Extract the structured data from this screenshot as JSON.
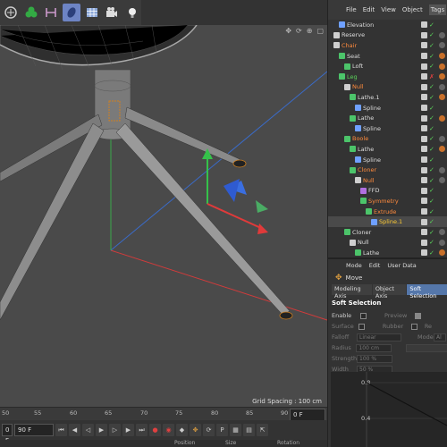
{
  "object_manager": {
    "menu": [
      "File",
      "Edit",
      "View",
      "Object",
      "Tags",
      "Bo"
    ],
    "active_menu": "Tags",
    "rows": [
      {
        "label": "Elevation",
        "indent": 1,
        "icon": "blue-arrow-icon",
        "color": "#dddddd",
        "mark": "✓",
        "mark_color": "#5bd35b",
        "tag_color": ""
      },
      {
        "label": "Reserve",
        "indent": 0,
        "icon": "null-icon",
        "color": "#dddddd",
        "mark": "✓",
        "mark_color": "#5bd35b",
        "tag_color": "#666666"
      },
      {
        "label": "Chair",
        "indent": 0,
        "icon": "null-icon",
        "color": "#ff8a3c",
        "mark": "✓",
        "mark_color": "#5bd35b",
        "tag_color": "#666666"
      },
      {
        "label": "Seat",
        "indent": 1,
        "icon": "generator-icon",
        "color": "#dddddd",
        "mark": "✓",
        "mark_color": "#5bd35b",
        "tag_color": "#c8702a"
      },
      {
        "label": "Loft",
        "indent": 2,
        "icon": "loft-icon",
        "color": "#dddddd",
        "mark": "✓",
        "mark_color": "#5bd35b",
        "tag_color": "#c8702a"
      },
      {
        "label": "Leg",
        "indent": 1,
        "icon": "generator-icon",
        "color": "#5bd35b",
        "mark": "✗",
        "mark_color": "#e04040",
        "tag_color": "#c8702a"
      },
      {
        "label": "Null",
        "indent": 2,
        "icon": "null-icon",
        "color": "#ff8a3c",
        "mark": "✓",
        "mark_color": "#5bd35b",
        "tag_color": "#666666"
      },
      {
        "label": "Lathe.1",
        "indent": 3,
        "icon": "lathe-icon",
        "color": "#dddddd",
        "mark": "✓",
        "mark_color": "#5bd35b",
        "tag_color": "#c8702a"
      },
      {
        "label": "Spline",
        "indent": 4,
        "icon": "spline-icon",
        "color": "#dddddd",
        "mark": "✓",
        "mark_color": "#5bd35b",
        "tag_color": ""
      },
      {
        "label": "Lathe",
        "indent": 3,
        "icon": "lathe-icon",
        "color": "#dddddd",
        "mark": "✓",
        "mark_color": "#5bd35b",
        "tag_color": "#c8702a"
      },
      {
        "label": "Spline",
        "indent": 4,
        "icon": "spline-icon",
        "color": "#dddddd",
        "mark": "✓",
        "mark_color": "#5bd35b",
        "tag_color": ""
      },
      {
        "label": "Boole",
        "indent": 2,
        "icon": "boole-icon",
        "color": "#ff8a3c",
        "mark": "✓",
        "mark_color": "#5bd35b",
        "tag_color": "#666666"
      },
      {
        "label": "Lathe",
        "indent": 3,
        "icon": "lathe-icon",
        "color": "#dddddd",
        "mark": "✓",
        "mark_color": "#5bd35b",
        "tag_color": "#c8702a"
      },
      {
        "label": "Spline",
        "indent": 4,
        "icon": "spline-icon",
        "color": "#dddddd",
        "mark": "✓",
        "mark_color": "#5bd35b",
        "tag_color": ""
      },
      {
        "label": "Cloner",
        "indent": 3,
        "icon": "cloner-icon",
        "color": "#ff8a3c",
        "mark": "✓",
        "mark_color": "#5bd35b",
        "tag_color": "#666666"
      },
      {
        "label": "Null",
        "indent": 4,
        "icon": "null-icon",
        "color": "#ff8a3c",
        "mark": "✓",
        "mark_color": "#5bd35b",
        "tag_color": "#666666"
      },
      {
        "label": "FFD",
        "indent": 5,
        "icon": "ffd-icon",
        "color": "#dddddd",
        "mark": "✓",
        "mark_color": "#5bd35b",
        "tag_color": ""
      },
      {
        "label": "Symmetry",
        "indent": 5,
        "icon": "symmetry-icon",
        "color": "#ff8a3c",
        "mark": "✓",
        "mark_color": "#5bd35b",
        "tag_color": ""
      },
      {
        "label": "Extrude",
        "indent": 6,
        "icon": "extrude-icon",
        "color": "#ff8a3c",
        "mark": "✓",
        "mark_color": "#5bd35b",
        "tag_color": ""
      },
      {
        "label": "Spline.1",
        "indent": 7,
        "icon": "spline-icon",
        "color": "#ffcc33",
        "mark": "✓",
        "mark_color": "#5bd35b",
        "tag_color": "",
        "highlight": true
      },
      {
        "label": "Cloner",
        "indent": 2,
        "icon": "cloner-icon",
        "color": "#dddddd",
        "mark": "✓",
        "mark_color": "#5bd35b",
        "tag_color": "#666666"
      },
      {
        "label": "Null",
        "indent": 3,
        "icon": "null-icon",
        "color": "#dddddd",
        "mark": "✓",
        "mark_color": "#5bd35b",
        "tag_color": "#666666"
      },
      {
        "label": "Lathe",
        "indent": 4,
        "icon": "lathe-icon",
        "color": "#dddddd",
        "mark": "✓",
        "mark_color": "#5bd35b",
        "tag_color": "#c8702a"
      }
    ]
  },
  "attributes": {
    "menu": [
      "Mode",
      "Edit",
      "User Data"
    ],
    "mode": "Move",
    "tabs": [
      "Modeling Axis",
      "Object Axis",
      "Soft Selection"
    ],
    "active_tab": "Soft Selection",
    "section": "Soft Selection",
    "enable_label": "Enable",
    "preview_label": "Preview",
    "surface_label": "Surface",
    "rubber_label": "Rubber",
    "re_label": "Re",
    "falloff_label": "Falloff",
    "falloff_value": "Linear",
    "mode_label": "Mode",
    "mode_value": "Al",
    "radius_label": "Radius",
    "radius_value": "100 cm",
    "strength_label": "Strength",
    "strength_value": "100 %",
    "width_label": "Width",
    "width_value": "50 %",
    "graph_top": "0.8",
    "graph_bottom": "0.4"
  },
  "viewport": {
    "grid_spacing": "Grid Spacing : 100 cm",
    "nav_icons": [
      "move-view-icon",
      "orbit-icon",
      "zoom-icon",
      "maximize-icon"
    ]
  },
  "timeline": {
    "ticks": [
      "50",
      "55",
      "60",
      "65",
      "70",
      "75",
      "80",
      "85",
      "90"
    ],
    "frame_start": "0 F",
    "frame_end": "90 F",
    "current_frame": "0 F"
  },
  "bottom": {
    "labels": [
      "Position",
      "Size",
      "Rotation"
    ]
  },
  "colors": {
    "viewport_bg": "#4a4a4a",
    "accent": "#5577aa",
    "orange": "#ff8a3c"
  }
}
